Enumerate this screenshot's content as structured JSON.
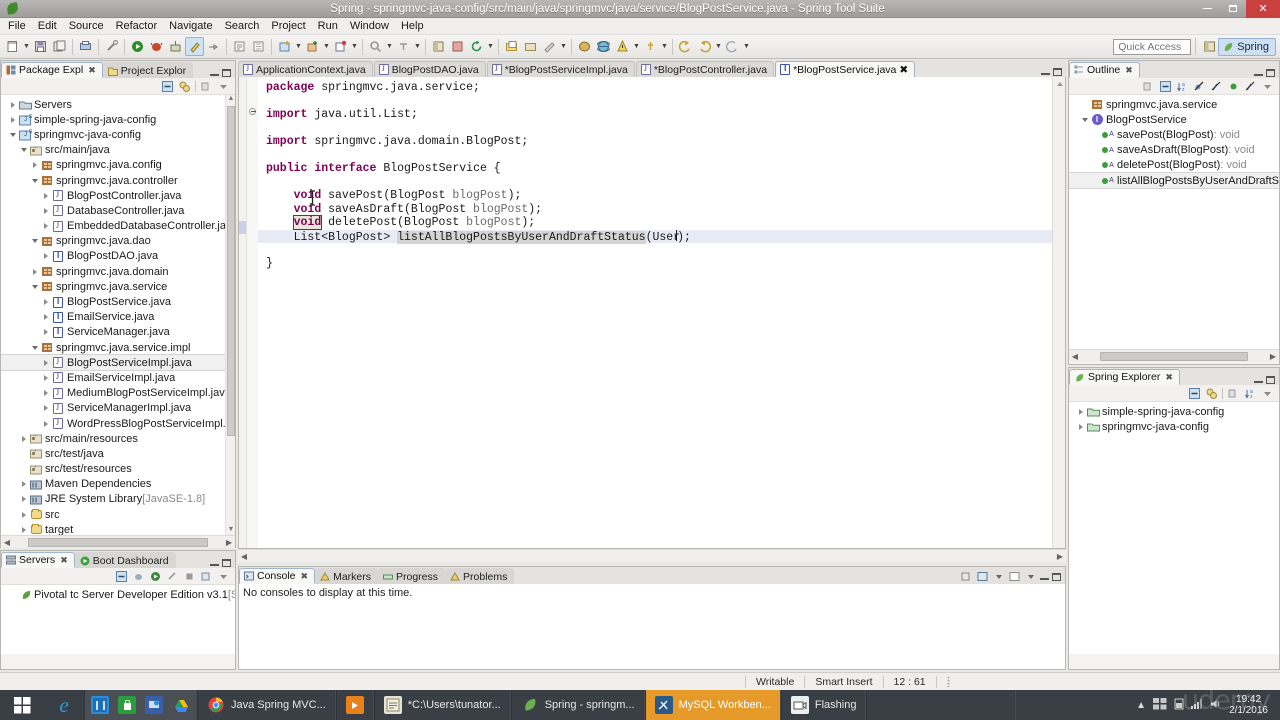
{
  "window": {
    "title": "Spring - springmvc-java-config/src/main/java/springmvc/java/service/BlogPostService.java - Spring Tool Suite",
    "app_icon": "spring-leaf-icon",
    "minimize": "minimize-button",
    "restore": "restore-button",
    "close": "close-button"
  },
  "menubar": {
    "items": [
      "File",
      "Edit",
      "Source",
      "Refactor",
      "Navigate",
      "Search",
      "Project",
      "Run",
      "Window",
      "Help"
    ]
  },
  "toolbar": {
    "quick_access_placeholder": "Quick Access",
    "perspective_label": "Spring"
  },
  "package_explorer": {
    "tabs": [
      {
        "label": "Package Expl",
        "active": true,
        "icon": "package-explorer-icon"
      },
      {
        "label": "Project Explor",
        "active": false,
        "icon": "project-explorer-icon"
      }
    ],
    "tree": [
      {
        "label": "Servers",
        "indent": 0,
        "twisty": "right",
        "icon": "server-folder-icon"
      },
      {
        "label": "simple-spring-java-config",
        "indent": 0,
        "twisty": "right",
        "icon": "java-project-icon"
      },
      {
        "label": "springmvc-java-config",
        "indent": 0,
        "twisty": "down",
        "icon": "java-project-icon"
      },
      {
        "label": "src/main/java",
        "indent": 1,
        "twisty": "down",
        "icon": "source-folder-icon"
      },
      {
        "label": "springmvc.java.config",
        "indent": 2,
        "twisty": "right",
        "icon": "package-icon"
      },
      {
        "label": "springmvc.java.controller",
        "indent": 2,
        "twisty": "down",
        "icon": "package-icon"
      },
      {
        "label": "BlogPostController.java",
        "indent": 3,
        "twisty": "right",
        "icon": "java-class-icon"
      },
      {
        "label": "DatabaseController.java",
        "indent": 3,
        "twisty": "right",
        "icon": "java-class-icon"
      },
      {
        "label": "EmbeddedDatabaseController.jav",
        "indent": 3,
        "twisty": "right",
        "icon": "java-class-icon"
      },
      {
        "label": "springmvc.java.dao",
        "indent": 2,
        "twisty": "down",
        "icon": "package-icon"
      },
      {
        "label": "BlogPostDAO.java",
        "indent": 3,
        "twisty": "right",
        "icon": "java-interface-icon"
      },
      {
        "label": "springmvc.java.domain",
        "indent": 2,
        "twisty": "right",
        "icon": "package-icon"
      },
      {
        "label": "springmvc.java.service",
        "indent": 2,
        "twisty": "down",
        "icon": "package-icon"
      },
      {
        "label": "BlogPostService.java",
        "indent": 3,
        "twisty": "right",
        "icon": "java-interface-icon"
      },
      {
        "label": "EmailService.java",
        "indent": 3,
        "twisty": "right",
        "icon": "java-interface-icon"
      },
      {
        "label": "ServiceManager.java",
        "indent": 3,
        "twisty": "right",
        "icon": "java-interface-icon"
      },
      {
        "label": "springmvc.java.service.impl",
        "indent": 2,
        "twisty": "down",
        "icon": "package-icon"
      },
      {
        "label": "BlogPostServiceImpl.java",
        "indent": 3,
        "twisty": "right",
        "icon": "java-class-icon",
        "selected": true
      },
      {
        "label": "EmailServiceImpl.java",
        "indent": 3,
        "twisty": "right",
        "icon": "java-class-icon"
      },
      {
        "label": "MediumBlogPostServiceImpl.java",
        "indent": 3,
        "twisty": "right",
        "icon": "java-class-icon"
      },
      {
        "label": "ServiceManagerImpl.java",
        "indent": 3,
        "twisty": "right",
        "icon": "java-class-icon"
      },
      {
        "label": "WordPressBlogPostServiceImpl.ja",
        "indent": 3,
        "twisty": "right",
        "icon": "java-class-icon"
      },
      {
        "label": "src/main/resources",
        "indent": 1,
        "twisty": "right",
        "icon": "source-folder-icon"
      },
      {
        "label": "src/test/java",
        "indent": 1,
        "twisty": "none",
        "icon": "source-folder-icon"
      },
      {
        "label": "src/test/resources",
        "indent": 1,
        "twisty": "none",
        "icon": "source-folder-icon"
      },
      {
        "label": "Maven Dependencies",
        "indent": 1,
        "twisty": "right",
        "icon": "library-icon"
      },
      {
        "label": "JRE System Library",
        "suffix": "[JavaSE-1.8]",
        "indent": 1,
        "twisty": "right",
        "icon": "library-icon"
      },
      {
        "label": "src",
        "indent": 1,
        "twisty": "right",
        "icon": "folder-icon"
      },
      {
        "label": "target",
        "indent": 1,
        "twisty": "right",
        "icon": "folder-icon"
      }
    ]
  },
  "servers_view": {
    "tabs": [
      {
        "label": "Servers",
        "active": true,
        "icon": "servers-icon"
      },
      {
        "label": "Boot Dashboard",
        "active": false,
        "icon": "boot-dashboard-icon"
      }
    ],
    "rows": [
      {
        "label": "Pivotal tc Server Developer Edition v3.1",
        "suffix": "[Stop",
        "icon": "server-icon"
      }
    ]
  },
  "editor": {
    "tabs": [
      {
        "label": "ApplicationContext.java",
        "active": false,
        "dirty": false
      },
      {
        "label": "BlogPostDAO.java",
        "active": false,
        "dirty": false
      },
      {
        "label": "*BlogPostServiceImpl.java",
        "active": false,
        "dirty": true
      },
      {
        "label": "*BlogPostController.java",
        "active": false,
        "dirty": true
      },
      {
        "label": "*BlogPostService.java",
        "active": true,
        "dirty": true
      }
    ],
    "code_lines": [
      {
        "n": 1,
        "tokens": [
          {
            "t": "package",
            "c": "kw"
          },
          {
            "t": " springmvc.java.service;",
            "c": "plain"
          }
        ]
      },
      {
        "n": 2,
        "tokens": []
      },
      {
        "n": 3,
        "fold": true,
        "tokens": [
          {
            "t": "import",
            "c": "kw"
          },
          {
            "t": " java.util.List;",
            "c": "plain"
          }
        ]
      },
      {
        "n": 4,
        "tokens": []
      },
      {
        "n": 5,
        "tokens": [
          {
            "t": "import",
            "c": "kw"
          },
          {
            "t": " springmvc.java.domain.BlogPost;",
            "c": "plain"
          }
        ]
      },
      {
        "n": 6,
        "tokens": []
      },
      {
        "n": 7,
        "tokens": [
          {
            "t": "public",
            "c": "kw"
          },
          {
            "t": " ",
            "c": "plain"
          },
          {
            "t": "interface",
            "c": "kw"
          },
          {
            "t": " BlogPostService {",
            "c": "plain"
          }
        ]
      },
      {
        "n": 8,
        "tokens": []
      },
      {
        "n": 9,
        "tokens": [
          {
            "t": "    ",
            "c": "plain"
          },
          {
            "t": "void",
            "c": "kw"
          },
          {
            "t": " savePost(BlogPost ",
            "c": "plain"
          },
          {
            "t": "blogPost",
            "c": "param"
          },
          {
            "t": ");",
            "c": "plain"
          }
        ]
      },
      {
        "n": 10,
        "tokens": [
          {
            "t": "    ",
            "c": "plain"
          },
          {
            "t": "void",
            "c": "kw"
          },
          {
            "t": " saveAsDraft(BlogPost ",
            "c": "plain"
          },
          {
            "t": "blogPost",
            "c": "param"
          },
          {
            "t": ");",
            "c": "plain"
          }
        ]
      },
      {
        "n": 11,
        "tokens": [
          {
            "t": "    ",
            "c": "plain"
          },
          {
            "t": "void",
            "c": "kw",
            "boxed": true
          },
          {
            "t": " deletePost(BlogPost ",
            "c": "plain"
          },
          {
            "t": "blogPost",
            "c": "param"
          },
          {
            "t": ");",
            "c": "plain"
          }
        ]
      },
      {
        "n": 12,
        "current": true,
        "tokens": [
          {
            "t": "    List<BlogPost> ",
            "c": "plain"
          },
          {
            "t": "listAllBlogPostsByUserAndDraftStatus",
            "c": "plain",
            "occ": true
          },
          {
            "t": "(User",
            "c": "plain"
          },
          {
            "t": ");",
            "c": "plain"
          }
        ]
      },
      {
        "n": 13,
        "tokens": []
      },
      {
        "n": 14,
        "tokens": [
          {
            "t": "}",
            "c": "plain"
          }
        ]
      }
    ]
  },
  "outline": {
    "tabs": [
      {
        "label": "Outline",
        "active": true,
        "icon": "outline-icon"
      }
    ],
    "rows": [
      {
        "label": "springmvc.java.service",
        "indent": 0,
        "twisty": "none",
        "icon": "package-icon"
      },
      {
        "label": "BlogPostService",
        "indent": 0,
        "twisty": "down",
        "icon": "interface-icon"
      },
      {
        "label": "savePost(BlogPost)",
        "suffix": " : void",
        "indent": 1,
        "twisty": "none",
        "icon": "method-abstract-icon"
      },
      {
        "label": "saveAsDraft(BlogPost)",
        "suffix": " : void",
        "indent": 1,
        "twisty": "none",
        "icon": "method-abstract-icon"
      },
      {
        "label": "deletePost(BlogPost)",
        "suffix": " : void",
        "indent": 1,
        "twisty": "none",
        "icon": "method-abstract-icon"
      },
      {
        "label": "listAllBlogPostsByUserAndDraftStatu",
        "suffix": "",
        "indent": 1,
        "twisty": "none",
        "icon": "method-abstract-icon",
        "selected": true
      }
    ]
  },
  "spring_explorer": {
    "tabs": [
      {
        "label": "Spring Explorer",
        "active": true,
        "icon": "spring-explorer-icon"
      }
    ],
    "rows": [
      {
        "label": "simple-spring-java-config",
        "twisty": "right",
        "icon": "spring-project-icon"
      },
      {
        "label": "springmvc-java-config",
        "twisty": "right",
        "icon": "spring-project-icon"
      }
    ]
  },
  "bottom_panel": {
    "tabs": [
      {
        "label": "Console",
        "active": true,
        "icon": "console-icon"
      },
      {
        "label": "Markers",
        "active": false,
        "icon": "markers-icon"
      },
      {
        "label": "Progress",
        "active": false,
        "icon": "progress-icon"
      },
      {
        "label": "Problems",
        "active": false,
        "icon": "problems-icon"
      }
    ],
    "content": "No consoles to display at this time."
  },
  "statusbar": {
    "writable": "Writable",
    "insert_mode": "Smart Insert",
    "position": "12 : 61"
  },
  "taskbar": {
    "start": "start-button",
    "pinned": [
      {
        "name": "internet-explorer",
        "label": ""
      },
      {
        "name": "file-explorer",
        "label": ""
      },
      {
        "name": "store",
        "label": ""
      },
      {
        "name": "remote-desktop",
        "label": ""
      },
      {
        "name": "google-drive",
        "label": ""
      }
    ],
    "tasks": [
      {
        "label": "Java Spring MVC...",
        "icon": "chrome-icon",
        "active": false
      },
      {
        "label": "",
        "icon": "media-player-icon",
        "active": false
      },
      {
        "label": "*C:\\Users\\tunator...",
        "icon": "editor-icon",
        "active": false
      },
      {
        "label": "Spring - springm...",
        "icon": "spring-leaf-icon",
        "active": false
      },
      {
        "label": "MySQL Workben...",
        "icon": "mysql-icon",
        "active": true
      },
      {
        "label": "Flashing",
        "icon": "camera-icon",
        "active": false
      }
    ],
    "clock_time": "19:42",
    "clock_date": "2/1/2016",
    "watermark": "udemy"
  },
  "colors": {
    "accent": "#cfe0f2",
    "keyword": "#7f0055",
    "close_red": "#c9403f",
    "taskbar_active": "#e59a2a",
    "taskbar_bg": "#3a3f46"
  }
}
